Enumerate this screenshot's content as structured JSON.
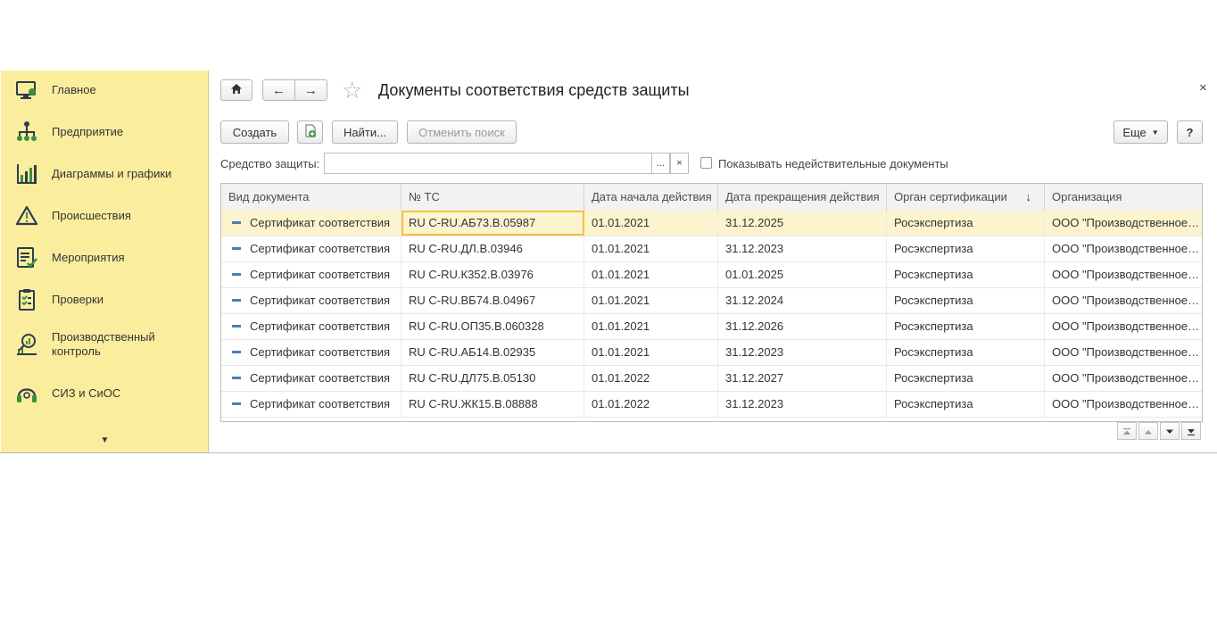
{
  "sidebar": {
    "items": [
      {
        "label": "Главное",
        "icon": "monitor-icon"
      },
      {
        "label": "Предприятие",
        "icon": "org-structure-icon"
      },
      {
        "label": "Диаграммы и графики",
        "icon": "bar-chart-icon"
      },
      {
        "label": "Происшествия",
        "icon": "warning-icon"
      },
      {
        "label": "Мероприятия",
        "icon": "checklist-icon"
      },
      {
        "label": "Проверки",
        "icon": "clipboard-icon"
      },
      {
        "label": "Производственный\nконтроль",
        "icon": "magnifier-chart-icon"
      },
      {
        "label": "СИЗ и СиОС",
        "icon": "headset-icon"
      }
    ],
    "more_glyph": "▼"
  },
  "header": {
    "title": "Документы соответствия средств защиты",
    "close_glyph": "×",
    "home_glyph": "⌂",
    "back_glyph": "←",
    "forward_glyph": "→",
    "favorite_glyph": "☆"
  },
  "toolbar": {
    "create_label": "Создать",
    "find_label": "Найти...",
    "cancel_search_label": "Отменить поиск",
    "more_label": "Еще",
    "help_label": "?"
  },
  "filter": {
    "label": "Средство защиты:",
    "value": "",
    "select_glyph": "...",
    "clear_glyph": "×",
    "checkbox_label": "Показывать недействительные документы",
    "checkbox_checked": false
  },
  "table": {
    "columns": [
      "Вид документа",
      "№ ТС",
      "Дата начала действия",
      "Дата прекращения действия",
      "Орган сертификации",
      "Организация"
    ],
    "sort_arrow": "↓",
    "rows": [
      [
        "Сертификат соответствия",
        "RU C-RU.АБ73.В.05987",
        "01.01.2021",
        "31.12.2025",
        "Росэкспертиза",
        "ООО \"Производственное объединение\""
      ],
      [
        "Сертификат соответствия",
        "RU C-RU.ДЛ.В.03946",
        "01.01.2021",
        "31.12.2023",
        "Росэкспертиза",
        "ООО \"Производственное объединение\""
      ],
      [
        "Сертификат соответствия",
        "RU C-RU.К352.В.03976",
        "01.01.2021",
        "01.01.2025",
        "Росэкспертиза",
        "ООО \"Производственное объединение\""
      ],
      [
        "Сертификат соответствия",
        "RU C-RU.ВБ74.В.04967",
        "01.01.2021",
        "31.12.2024",
        "Росэкспертиза",
        "ООО \"Производственное объединение\""
      ],
      [
        "Сертификат соответствия",
        "RU C-RU.ОП35.В.060328",
        "01.01.2021",
        "31.12.2026",
        "Росэкспертиза",
        "ООО \"Производственное объединение\""
      ],
      [
        "Сертификат соответствия",
        "RU C-RU.АБ14.В.02935",
        "01.01.2021",
        "31.12.2023",
        "Росэкспертиза",
        "ООО \"Производственное объединение\""
      ],
      [
        "Сертификат соответствия",
        "RU C-RU.ДЛ75.В.05130",
        "01.01.2022",
        "31.12.2027",
        "Росэкспертиза",
        "ООО \"Производственное объединение\""
      ],
      [
        "Сертификат соответствия",
        "RU C-RU.ЖК15.В.08888",
        "01.01.2022",
        "31.12.2023",
        "Росэкспертиза",
        "ООО \"Производственное объединение\""
      ]
    ],
    "selected_row": 0
  },
  "colors": {
    "sidebar_bg": "#fbed9e",
    "selected_row_bg": "#fcf3cf",
    "focus_border": "#f3c33c",
    "icon_green": "#3a8f3a",
    "icon_dark": "#2e3b4e"
  }
}
